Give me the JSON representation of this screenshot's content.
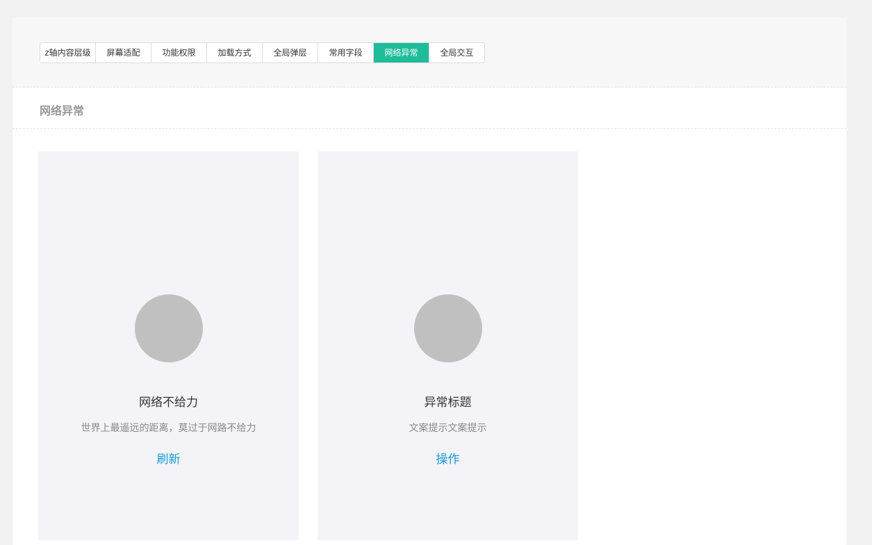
{
  "tabs": [
    {
      "label": "z轴内容层级",
      "active": false
    },
    {
      "label": "屏幕适配",
      "active": false
    },
    {
      "label": "功能权限",
      "active": false
    },
    {
      "label": "加载方式",
      "active": false
    },
    {
      "label": "全局弹层",
      "active": false
    },
    {
      "label": "常用字段",
      "active": false
    },
    {
      "label": "网络异常",
      "active": true
    },
    {
      "label": "全局交互",
      "active": false
    }
  ],
  "section": {
    "title": "网络异常"
  },
  "cards": [
    {
      "icon": "placeholder-circle-icon",
      "title": "网络不给力",
      "description": "世界上最遥远的距离，莫过于网路不给力",
      "action": "刷新"
    },
    {
      "icon": "placeholder-circle-icon",
      "title": "异常标题",
      "description": "文案提示文案提示",
      "action": "操作"
    }
  ],
  "colors": {
    "accent": "#1ebc98",
    "link": "#1a9bd6",
    "card_bg": "#f4f4f8",
    "placeholder": "#c0c0c0"
  }
}
